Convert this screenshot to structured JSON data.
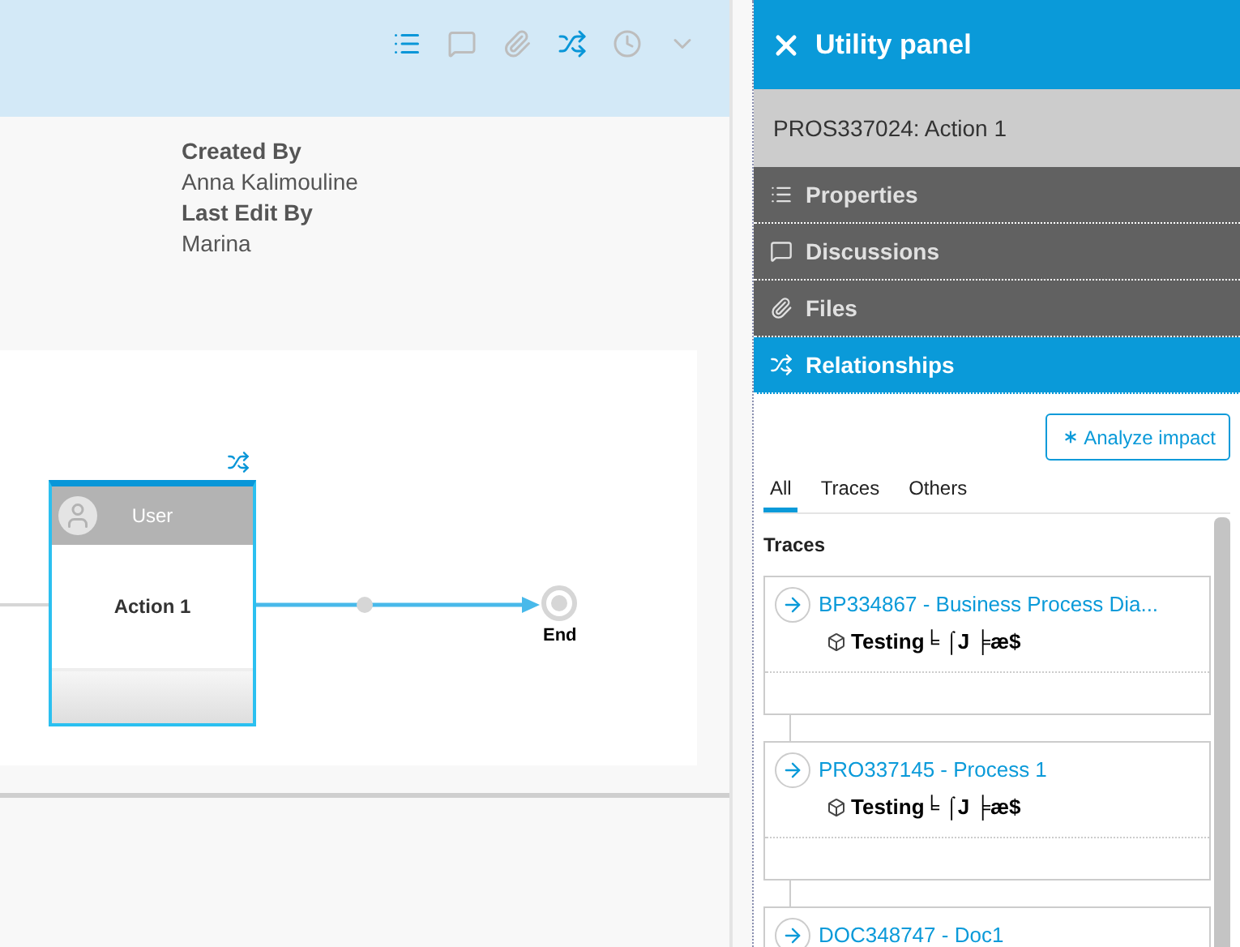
{
  "toolbar": [
    {
      "kind": "properties",
      "selected": true
    },
    {
      "kind": "discussions",
      "selected": false
    },
    {
      "kind": "files",
      "selected": false
    },
    {
      "kind": "relationships",
      "selected": true
    },
    {
      "kind": "history",
      "selected": false
    },
    {
      "kind": "menu",
      "selected": false
    }
  ],
  "info": [
    {
      "label": "Created By",
      "value": "Anna Kalimouline"
    },
    {
      "label": "Last Edit By",
      "value": "Marina"
    }
  ],
  "diagram": {
    "node": {
      "lane": "User",
      "title": "Action 1"
    },
    "end": "End"
  },
  "panel": {
    "title": "Utility panel",
    "item": "PROS337024: Action 1",
    "sections": [
      {
        "kind": "properties",
        "label": "Properties",
        "expanded": false
      },
      {
        "kind": "discussions",
        "label": "Discussions",
        "expanded": false
      },
      {
        "kind": "files",
        "label": "Files",
        "expanded": false
      },
      {
        "kind": "relationships",
        "label": "Relationships",
        "expanded": true
      }
    ],
    "analyze": "Analyze impact",
    "tabs": [
      {
        "label": "All",
        "selected": true
      },
      {
        "label": "Traces",
        "selected": false
      },
      {
        "label": "Others",
        "selected": false
      }
    ],
    "heading": "Traces",
    "traces": [
      {
        "title": "BP334867 - Business Process Dia...",
        "subtitle": "Testing╘ ⌠J ╞æ$"
      },
      {
        "title": "PRO337145 - Process 1",
        "subtitle": "Testing╘ ⌠J ╞æ$"
      },
      {
        "title": "DOC348747 - Doc1"
      }
    ]
  }
}
